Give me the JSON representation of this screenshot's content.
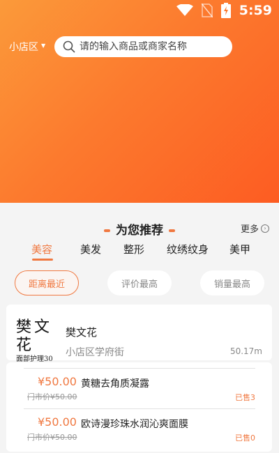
{
  "status": {
    "time": "5:59"
  },
  "header": {
    "location": "小店区",
    "search_placeholder": "请的输入商品或商家名称"
  },
  "recommend": {
    "title": "为您推荐",
    "more": "更多",
    "tabs": [
      "美容",
      "美发",
      "整形",
      "纹绣纹身",
      "美甲"
    ],
    "active_tab": "美容"
  },
  "filters": [
    "距离最近",
    "评价最高",
    "销量最高"
  ],
  "store": {
    "logo_text": "樊文花",
    "logo_subtext": "面部护理30",
    "name": "樊文花",
    "address": "小店区学府街",
    "distance": "50.17m"
  },
  "products": [
    {
      "price": "¥50.00",
      "name": "黄糖去角质凝露",
      "original": "门市价¥50.00",
      "sold": "已售3"
    },
    {
      "price": "¥50.00",
      "name": "欧诗漫珍珠水润沁爽面膜",
      "original": "门市价¥50.00",
      "sold": "已售0"
    }
  ],
  "colors": {
    "accent": "#f07840",
    "hero_start": "#fb9a3a",
    "hero_end": "#fd5c22"
  }
}
